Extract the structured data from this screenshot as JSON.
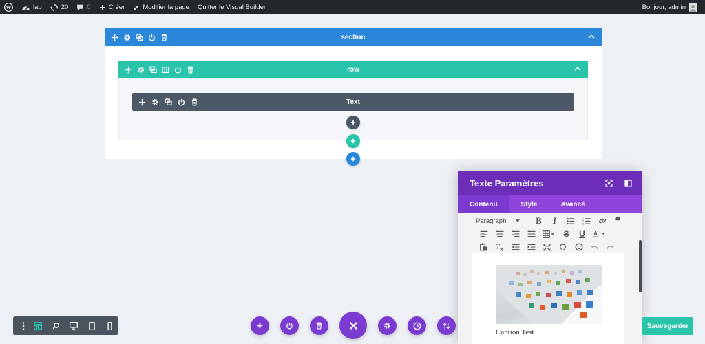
{
  "adminbar": {
    "site_name": "lab",
    "updates_count": "20",
    "comments_count": "0",
    "create_label": "Créer",
    "edit_page_label": "Modifier la page",
    "exit_builder_label": "Quitter le Visual Builder",
    "greeting": "Bonjour, admin"
  },
  "builder": {
    "section_title": "section",
    "row_title": "row",
    "module_title": "Text",
    "colors": {
      "section": "#2b87da",
      "row": "#29c4a9",
      "module": "#4c5866",
      "purple": "#7b3bd0"
    }
  },
  "modal": {
    "title": "Texte Paramètres",
    "tabs": [
      {
        "label": "Contenu",
        "active": true
      },
      {
        "label": "Style",
        "active": false
      },
      {
        "label": "Avancé",
        "active": false
      }
    ],
    "format_select": "Paragraph",
    "caption": "Caption Test"
  },
  "footer": {
    "save_label": "Sauvegarder"
  }
}
